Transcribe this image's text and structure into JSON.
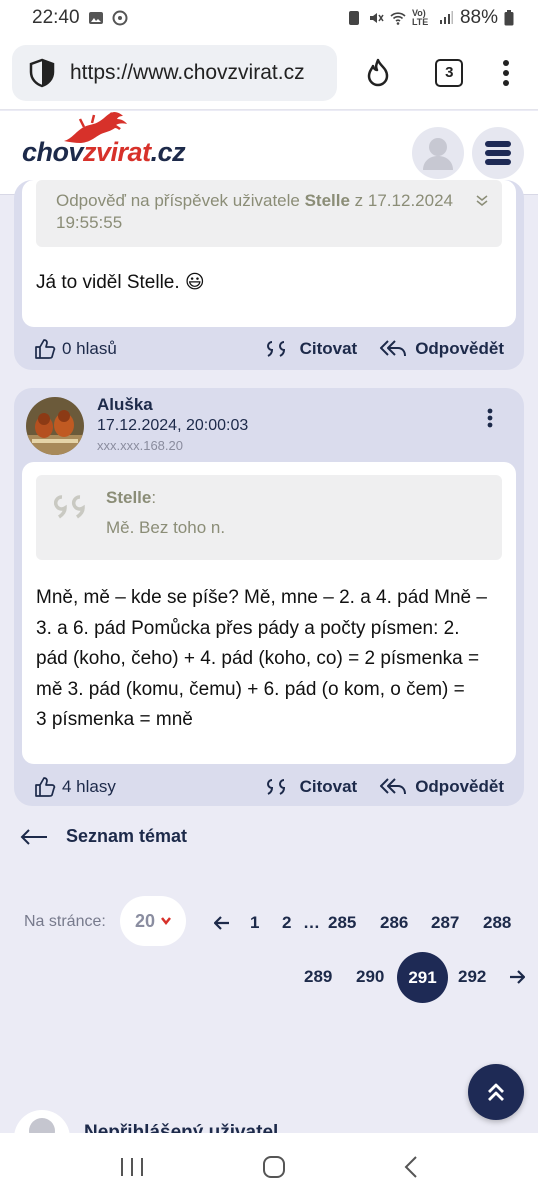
{
  "status_bar": {
    "time": "22:40",
    "battery": "88%",
    "network_label": "Vo) LTE"
  },
  "browser": {
    "url": "https://www.chovzvirat.cz",
    "tab_count": "3"
  },
  "site": {
    "logo_part1": "chov",
    "logo_part2": "zvirat",
    "logo_part3": ".cz"
  },
  "post1": {
    "reply_info_prefix": "Odpověď na příspěvek uživatele ",
    "reply_info_user": "Stelle",
    "reply_info_suffix": " z 17.12.2024",
    "reply_info_time": "19:55:55",
    "text": "Já to viděl Stelle.",
    "emoji": "😃",
    "votes": "0 hlasů",
    "quote_label": "Citovat",
    "reply_label": "Odpovědět"
  },
  "post2": {
    "author": "Aluška",
    "date": "17.12.2024, 20:00:03",
    "ip": "xxx.xxx.168.20",
    "quote_author": "Stelle",
    "quote_colon": ":",
    "quote_text": "Mě. Bez toho n.",
    "text_lines": [
      "Mně, mě – kde se píše? Mě, mne – 2. a 4. pád Mně –",
      "3. a 6. pád Pomůcka přes pády a počty písmen: 2.",
      "pád (koho, čeho) + 4. pád (koho, co) = 2 písmenka =",
      "mě 3. pád (komu, čemu) + 6. pád (o kom, o čem) =",
      "3 písmenka = mně"
    ],
    "votes": "4 hlasy",
    "quote_label": "Citovat",
    "reply_label": "Odpovědět"
  },
  "back_link": "Seznam témat",
  "pager": {
    "per_page_label": "Na stránce:",
    "per_page_value": "20",
    "row1": [
      "1",
      "2",
      "…",
      "285",
      "286",
      "287",
      "288"
    ],
    "row2": [
      "289",
      "290"
    ],
    "active": "291",
    "after": "292"
  },
  "next_post_author": "Nepřihlášený uživatel",
  "colors": {
    "navy": "#1e2a55",
    "brand_red": "#d7312a",
    "card_bg": "#dadced",
    "page_bg": "#ebebf5"
  }
}
